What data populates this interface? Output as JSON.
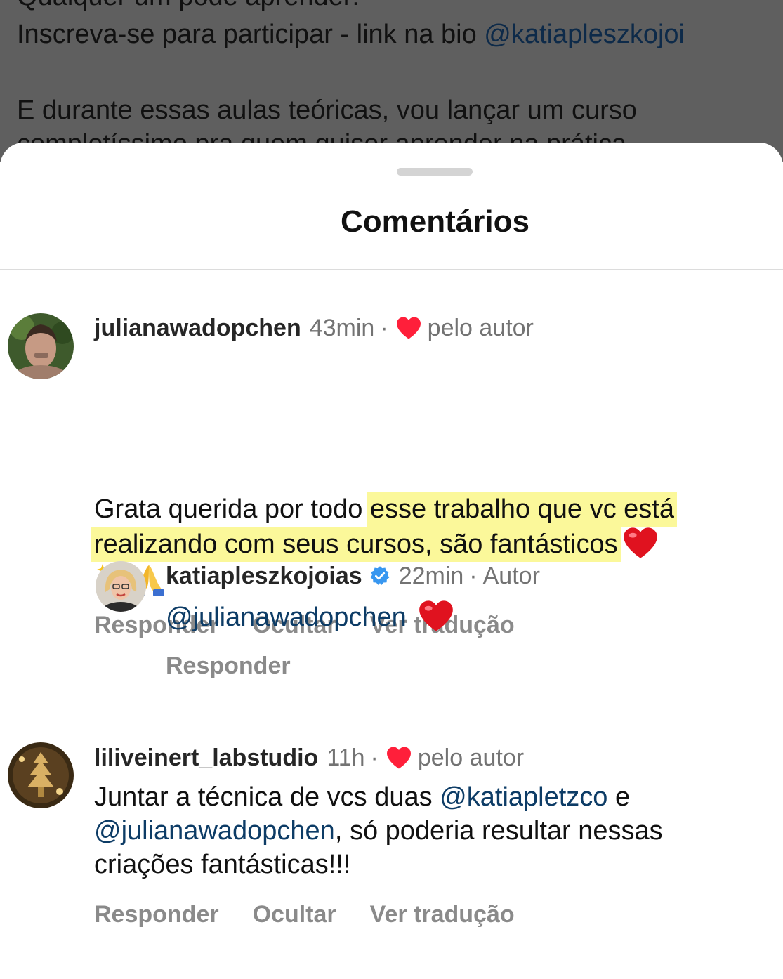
{
  "background_post": {
    "line1": "Qualquer um pode aprender!",
    "line2_text": "Inscreva-se para participar - link na bio ",
    "line2_mention": "@katiapleszkojoi",
    "line3": "E durante essas aulas teóricas, vou lançar um curso",
    "line4": "completíssimo pra quem quiser aprender na prática"
  },
  "sheet": {
    "title": "Comentários"
  },
  "comments": [
    {
      "username": "julianawadopchen",
      "time": "43min",
      "dot": "·",
      "liked_label": "pelo autor",
      "text_plain": "Grata querida por todo ",
      "text_highlight_1": "esse trabalho que vc está",
      "text_highlight_2": "realizando com seus cursos, são fantásticos",
      "actions": [
        "Responder",
        "Ocultar",
        "Ver tradução"
      ]
    },
    {
      "username": "katiapleszkojoias",
      "time": "22min",
      "dot": "·",
      "author_label": "Autor",
      "mention": "@julianawadopchen",
      "actions": [
        "Responder"
      ]
    },
    {
      "username": "liliveinert_labstudio",
      "time": "11h",
      "dot": "·",
      "liked_label": "pelo autor",
      "text_1": "Juntar a técnica de vcs duas ",
      "mention_1": "@katiapletzco",
      "text_2": " e",
      "mention_2": "@julianawadopchen",
      "text_3": ", só poderia resultar nessas",
      "text_4": "criações fantásticas!!!",
      "actions": [
        "Responder",
        "Ocultar",
        "Ver tradução"
      ]
    }
  ],
  "colors": {
    "like_heart": "#ff1f3a",
    "mention": "#0d3c66",
    "verified": "#3897f0",
    "highlight": "#faf578"
  }
}
